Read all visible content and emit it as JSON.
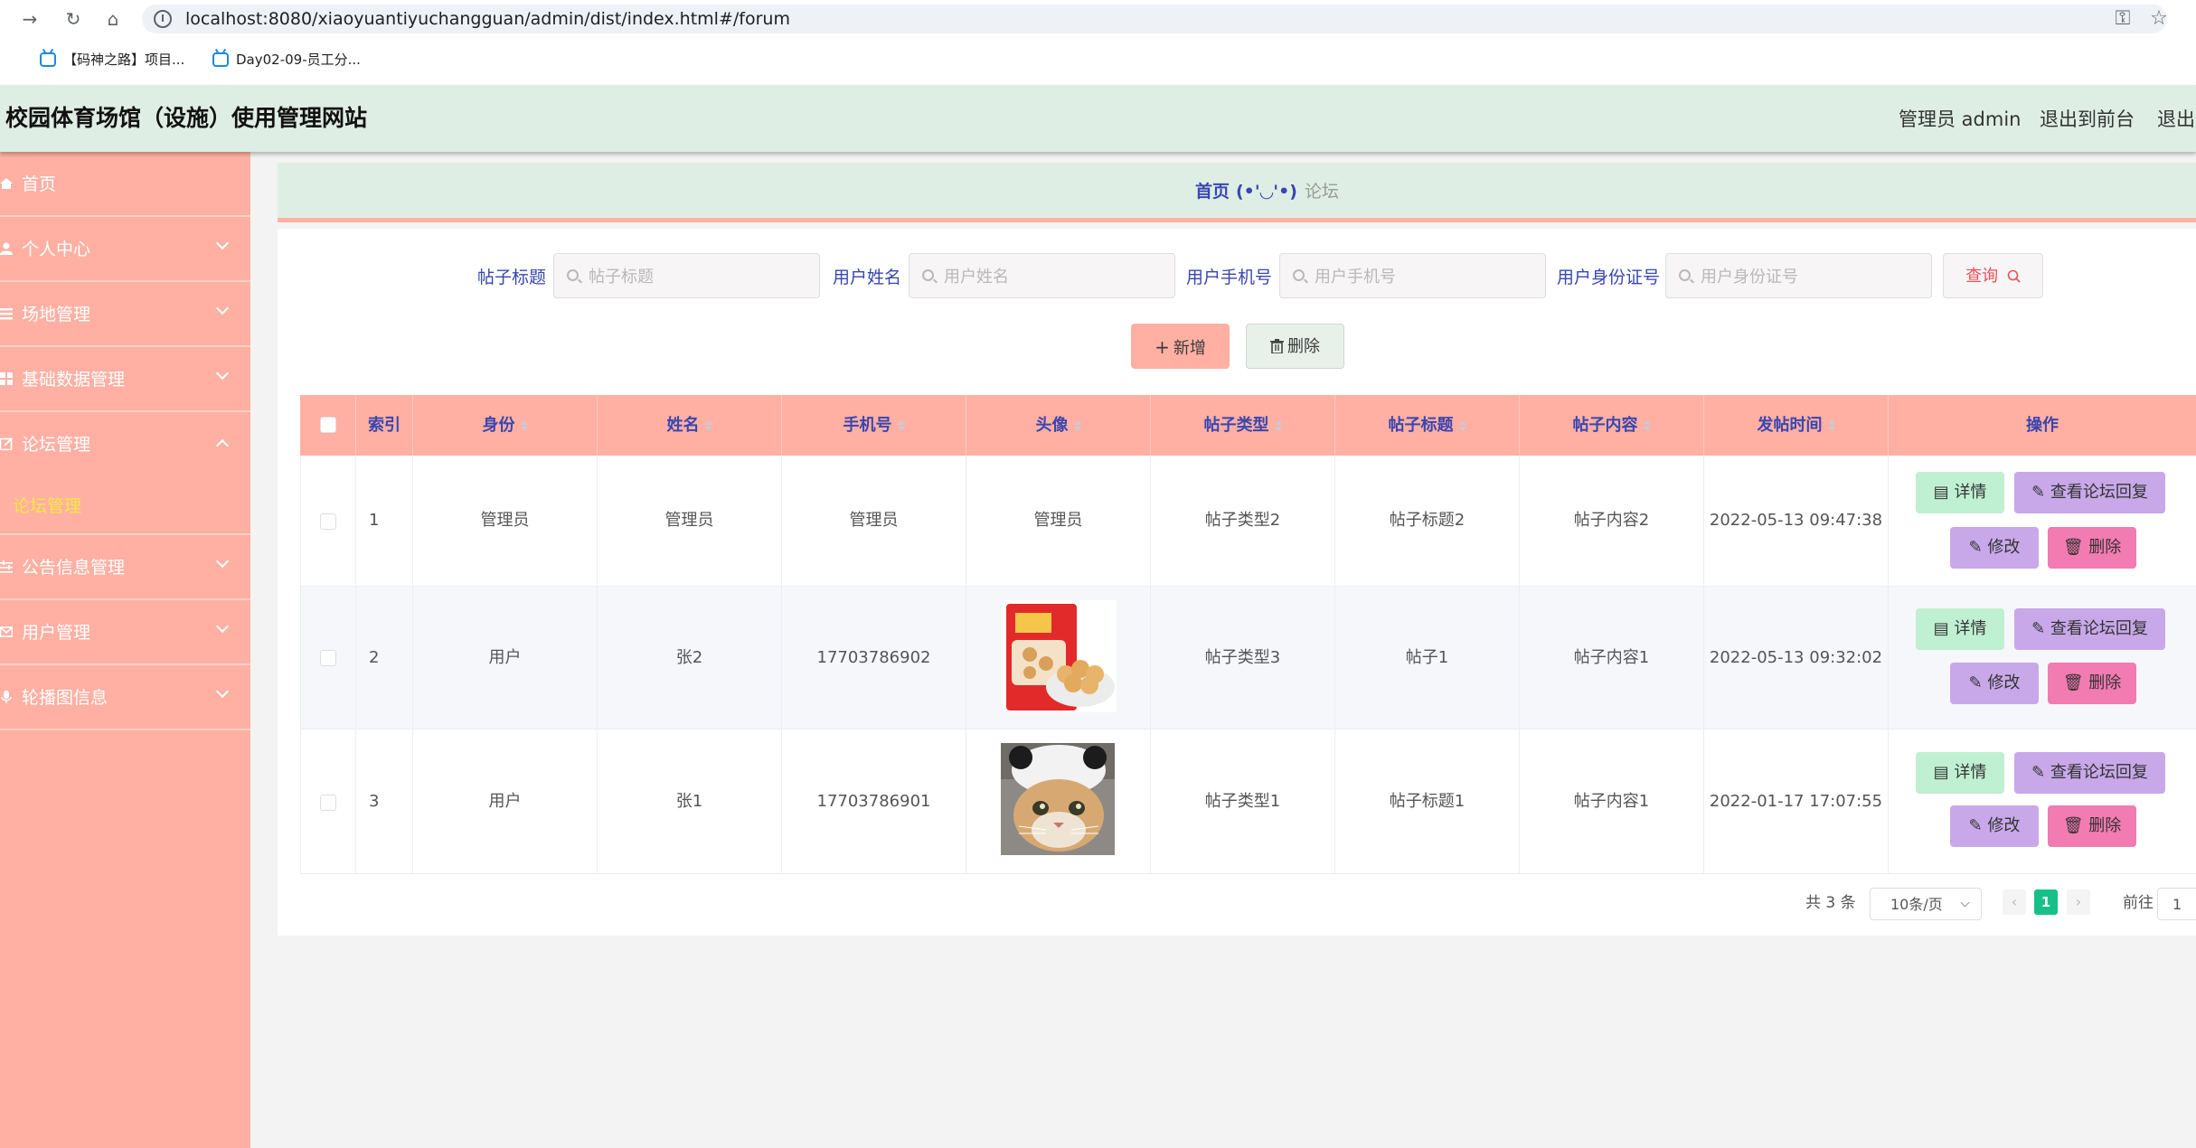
{
  "browser": {
    "url": "localhost:8080/xiaoyuantiyuchangguan/admin/dist/index.html#/forum",
    "bookmarks": [
      "【码神之路】项目...",
      "Day02-09-员工分..."
    ]
  },
  "header": {
    "title": "校园体育场馆（设施）使用管理网站",
    "user": "管理员 admin",
    "to_front": "退出到前台",
    "logout": "退出登录"
  },
  "sidebar": {
    "items": [
      {
        "label": "首页",
        "has_children": false
      },
      {
        "label": "个人中心",
        "has_children": true
      },
      {
        "label": "场地管理",
        "has_children": true
      },
      {
        "label": "基础数据管理",
        "has_children": true
      },
      {
        "label": "论坛管理",
        "has_children": true,
        "expanded": true
      },
      {
        "label": "公告信息管理",
        "has_children": true
      },
      {
        "label": "用户管理",
        "has_children": true
      },
      {
        "label": "轮播图信息",
        "has_children": true
      }
    ],
    "sub_active": "论坛管理"
  },
  "breadcrumb": {
    "home": "首页",
    "emoticon": "(•'◡'•)",
    "current": "论坛"
  },
  "search": {
    "fields": [
      {
        "label": "帖子标题",
        "placeholder": "帖子标题"
      },
      {
        "label": "用户姓名",
        "placeholder": "用户姓名"
      },
      {
        "label": "用户手机号",
        "placeholder": "用户手机号"
      },
      {
        "label": "用户身份证号",
        "placeholder": "用户身份证号"
      }
    ],
    "query_label": "查询"
  },
  "actions": {
    "add_label": "新增",
    "delete_label": "删除"
  },
  "table": {
    "columns": [
      "索引",
      "身份",
      "姓名",
      "手机号",
      "头像",
      "帖子类型",
      "帖子标题",
      "帖子内容",
      "发帖时间",
      "操作"
    ],
    "rows": [
      {
        "index": "1",
        "role": "管理员",
        "name": "管理员",
        "phone": "管理员",
        "avatar": "管理员",
        "avatar_type": "text",
        "type": "帖子类型2",
        "title": "帖子标题2",
        "content": "帖子内容2",
        "time": "2022-05-13 09:47:38"
      },
      {
        "index": "2",
        "role": "用户",
        "name": "张2",
        "phone": "17703786902",
        "avatar": "",
        "avatar_type": "snack",
        "type": "帖子类型3",
        "title": "帖子1",
        "content": "帖子内容1",
        "time": "2022-05-13 09:32:02"
      },
      {
        "index": "3",
        "role": "用户",
        "name": "张1",
        "phone": "17703786901",
        "avatar": "",
        "avatar_type": "cat",
        "type": "帖子类型1",
        "title": "帖子标题1",
        "content": "帖子内容1",
        "time": "2022-01-17 17:07:55"
      }
    ],
    "op_labels": {
      "detail": "详情",
      "reply": "查看论坛回复",
      "edit": "修改",
      "delete": "删除"
    }
  },
  "pagination": {
    "total_text": "共 3 条",
    "page_size": "10条/页",
    "current_page": "1",
    "goto_label": "前往",
    "goto_value": "1"
  },
  "colors": {
    "accent": "#ffb0a3",
    "header_bg": "#deeee5",
    "label_blue": "#3a46b0",
    "active_sub": "#f4e843",
    "page_active": "#17c088"
  }
}
